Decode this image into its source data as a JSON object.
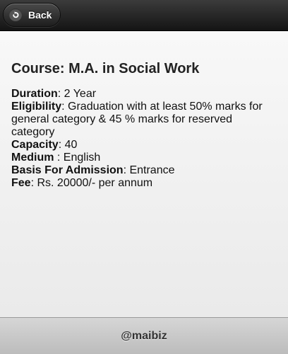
{
  "header": {
    "back_label": "Back"
  },
  "course": {
    "title": "Course: M.A. in Social Work",
    "details": [
      {
        "key": "Duration",
        "sep": ": ",
        "value": "2 Year"
      },
      {
        "key": "Eligibility",
        "sep": ": ",
        "value": "Graduation with at least 50% marks for general category & 45 % marks for reserved category"
      },
      {
        "key": "Capacity",
        "sep": ": ",
        "value": "40"
      },
      {
        "key": "Medium",
        "sep": " : ",
        "value": "English"
      },
      {
        "key": "Basis For Admission",
        "sep": ": ",
        "value": "Entrance"
      },
      {
        "key": "Fee",
        "sep": ": ",
        "value": "Rs. 20000/- per annum"
      }
    ]
  },
  "footer": {
    "text": "@maibiz"
  },
  "icons": {
    "back": "back-arrow-icon"
  },
  "colors": {
    "header_bg": "#1a1a1a",
    "footer_bg": "#c8c8c8",
    "content_bg": "#f2f2f2"
  }
}
